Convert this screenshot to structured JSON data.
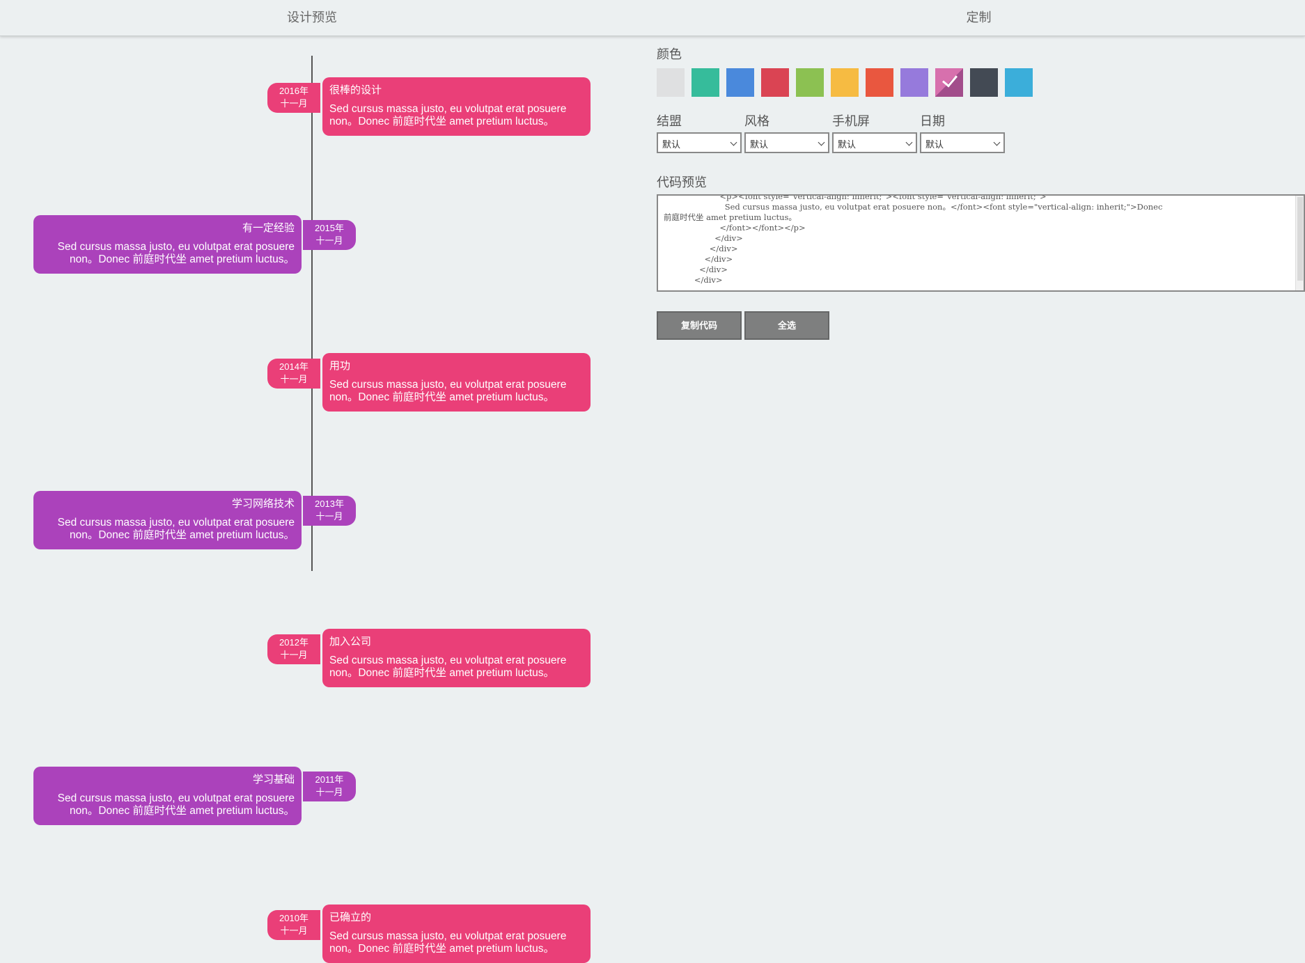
{
  "tabs": {
    "preview": "设计预览",
    "customize": "定制"
  },
  "timeline": [
    {
      "year": "2016年",
      "month": "十一月",
      "title": "很棒的设计",
      "body1": "Sed cursus massa justo, eu volutpat erat posuere",
      "body2": "non。Donec 前庭时代坐 amet pretium luctus。",
      "side": "right",
      "color": "#ea3f78"
    },
    {
      "year": "2015年",
      "month": "十一月",
      "title": "有一定经验",
      "body1": "Sed cursus massa justo, eu volutpat erat posuere",
      "body2": "non。Donec 前庭时代坐 amet pretium luctus。",
      "side": "left",
      "color": "#ab42bb"
    },
    {
      "year": "2014年",
      "month": "十一月",
      "title": "用功",
      "body1": "Sed cursus massa justo, eu volutpat erat posuere",
      "body2": "non。Donec 前庭时代坐 amet pretium luctus。",
      "side": "right",
      "color": "#ea3f78"
    },
    {
      "year": "2013年",
      "month": "十一月",
      "title": "学习网络技术",
      "body1": "Sed cursus massa justo, eu volutpat erat posuere",
      "body2": "non。Donec 前庭时代坐 amet pretium luctus。",
      "side": "left",
      "color": "#ab42bb"
    },
    {
      "year": "2012年",
      "month": "十一月",
      "title": "加入公司",
      "body1": "Sed cursus massa justo, eu volutpat erat posuere",
      "body2": "non。Donec 前庭时代坐 amet pretium luctus。",
      "side": "right",
      "color": "#ea3f78"
    },
    {
      "year": "2011年",
      "month": "十一月",
      "title": "学习基础",
      "body1": "Sed cursus massa justo, eu volutpat erat posuere",
      "body2": "non。Donec 前庭时代坐 amet pretium luctus。",
      "side": "left",
      "color": "#ab42bb"
    },
    {
      "year": "2010年",
      "month": "十一月",
      "title": "已确立的",
      "body1": "Sed cursus massa justo, eu volutpat erat posuere",
      "body2": "non。Donec 前庭时代坐 amet pretium luctus。",
      "side": "right",
      "color": "#ea3f78"
    }
  ],
  "color_section": {
    "label": "颜色",
    "swatches": [
      "#dfe0e1",
      "#36bc9b",
      "#4a89dc",
      "#da4453",
      "#8cc152",
      "#f6bb42",
      "#e9573f",
      "#967adc",
      "#d770ad",
      "#434a54",
      "#3baeda"
    ],
    "selected_index": 8,
    "selected_split_color": "#a24d8b"
  },
  "options": [
    {
      "label": "结盟",
      "value": "默认"
    },
    {
      "label": "风格",
      "value": "默认"
    },
    {
      "label": "手机屏",
      "value": "默认"
    },
    {
      "label": "日期",
      "value": "默认"
    }
  ],
  "code_preview": {
    "label": "代码预览",
    "lines": [
      "                      <p><font style=\"vertical-align: inherit;\"><font style=\"vertical-align: inherit;\">",
      "                        Sed cursus massa justo, eu volutpat erat posuere non。</font><font style=\"vertical-align: inherit;\">Donec",
      "前庭时代坐 amet pretium luctus。",
      "                      </font></font></p>",
      "                    </div>",
      "                  </div>",
      "                </div>",
      "              </div>",
      "            </div>"
    ]
  },
  "buttons": {
    "copy": "复制代码",
    "select_all": "全选"
  }
}
